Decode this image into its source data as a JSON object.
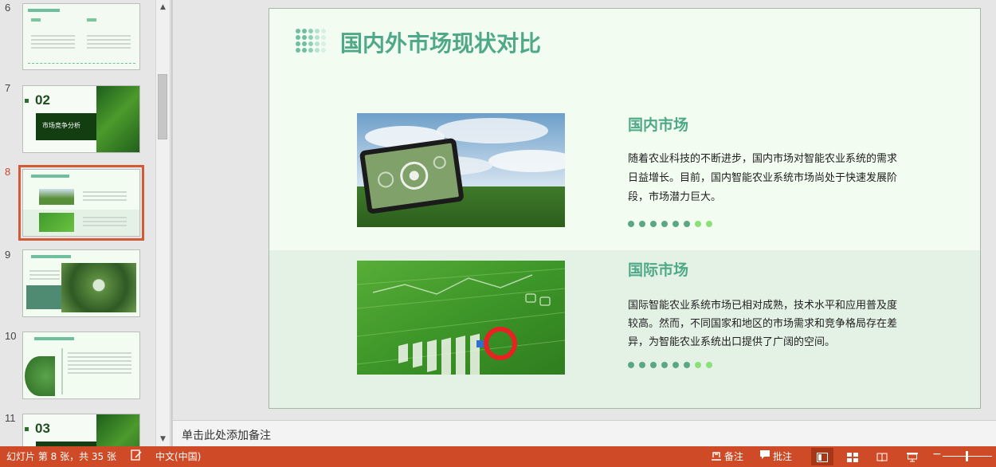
{
  "thumbnails": [
    {
      "number": "6"
    },
    {
      "number": "7",
      "big_label": "02",
      "title": "市场竞争分析"
    },
    {
      "number": "8",
      "active": true
    },
    {
      "number": "9"
    },
    {
      "number": "10"
    },
    {
      "number": "11",
      "big_label": "03"
    }
  ],
  "slide": {
    "title": "国内外市场现状对比",
    "domestic": {
      "title": "国内市场",
      "body": "随着农业科技的不断进步，国内市场对智能农业系统的需求日益增长。目前，国内智能农业系统市场尚处于快速发展阶段，市场潜力巨大。"
    },
    "international": {
      "title": "国际市场",
      "body": "国际智能农业系统市场已相对成熟，技术水平和应用普及度较高。然而，不同国家和地区的市场需求和竞争格局存在差异，为智能农业系统出口提供了广阔的空间。"
    }
  },
  "notes_placeholder": "单击此处添加备注",
  "statusbar": {
    "slide_info": "幻灯片 第 8 张，共 35 张",
    "language": "中文(中国)",
    "notes_label": "备注",
    "comments_label": "批注",
    "zoom_minus": "−"
  },
  "colors": {
    "accent": "#4fa989",
    "status_bar": "#cf4a26",
    "selection": "#d25a35"
  }
}
